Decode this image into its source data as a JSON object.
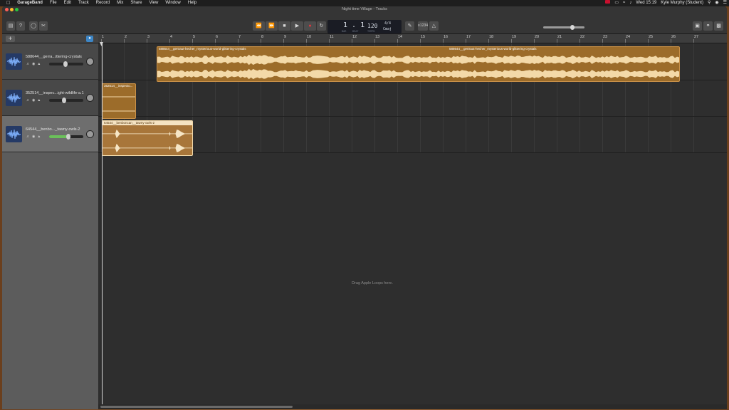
{
  "menubar": {
    "apple_icon": "apple-logo",
    "app_name": "GarageBand",
    "items": [
      "File",
      "Edit",
      "Track",
      "Record",
      "Mix",
      "Share",
      "View",
      "Window",
      "Help"
    ],
    "clock": "Wed 15:19",
    "user": "Kyle Murphy (Student)"
  },
  "window": {
    "title": "Night time Village - Tracks"
  },
  "toolbar": {
    "left_buttons": [
      "library-icon",
      "help-icon",
      "smart-controls-icon",
      "scissors-icon"
    ],
    "transport": [
      "rewind-icon",
      "fast-forward-icon",
      "stop-icon",
      "play-icon",
      "record-icon",
      "cycle-icon"
    ],
    "lcd": {
      "position": "1 . 1",
      "bar_label": "BAR",
      "beat_label": "BEAT",
      "tempo": "120",
      "tempo_label": "TEMPO",
      "signature": "4/4",
      "key": "Cmaj"
    },
    "tuner_icon": "tuner-icon",
    "count_in": "≡1234",
    "metronome_icon": "metronome-icon",
    "master_volume_level": 0.68,
    "right_buttons": [
      "notepad-icon",
      "loop-browser-icon",
      "media-browser-icon"
    ]
  },
  "ruler": {
    "bars": [
      "1",
      "2",
      "3",
      "4",
      "5",
      "6",
      "7",
      "8",
      "9",
      "10",
      "11",
      "12",
      "13",
      "14",
      "15",
      "16",
      "17",
      "18",
      "19",
      "20",
      "21",
      "22",
      "23",
      "24",
      "25",
      "26",
      "27"
    ]
  },
  "tracks": [
    {
      "name": "588644__gerra...ittering-crystals",
      "volume": 0.55,
      "selected": false
    },
    {
      "name": "352514__inspec...ight-wildlife-a.1",
      "volume": 0.5,
      "selected": false
    },
    {
      "name": "64544__benbo..._tawny-owls-2",
      "volume": 0.65,
      "selected": true
    }
  ],
  "regions": [
    {
      "label": "588644__gertraut-hecher_mysterious-world-glittering-crystals",
      "label2": "588644__gertraut-hecher_mysterious-world-glittering-crystals"
    },
    {
      "label": "352514__inspecto..."
    },
    {
      "label": "64544__benboncan__tawny-owls-2"
    }
  ],
  "hint": "Drag Apple Loops here."
}
